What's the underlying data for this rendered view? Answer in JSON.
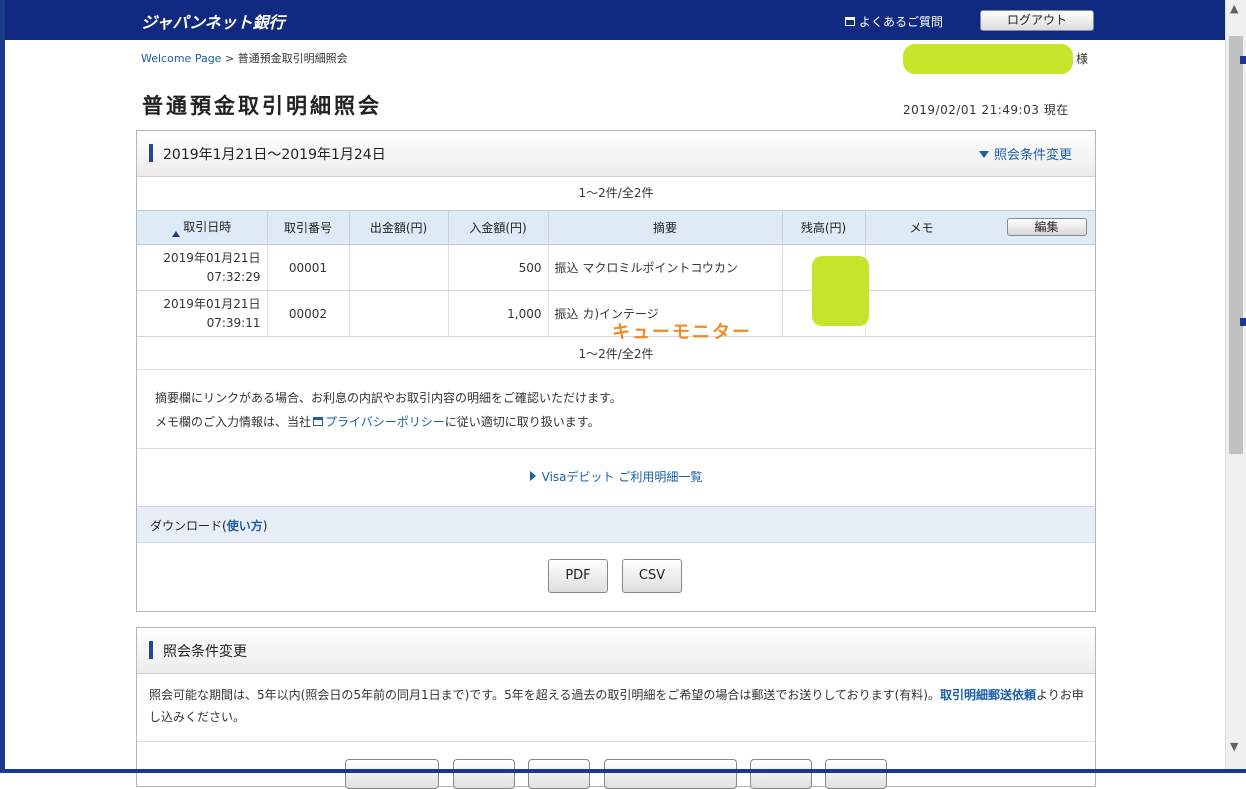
{
  "header": {
    "logo": "ジャパンネット銀行",
    "faq_label": "よくあるご質問",
    "logout_label": "ログアウト"
  },
  "breadcrumb": {
    "home": "Welcome Page",
    "separator": ">",
    "current": "普通預金取引明細照会"
  },
  "user": {
    "honorific": "様"
  },
  "page": {
    "title": "普通預金取引明細照会",
    "timestamp": "2019/02/01  21:49:03 現在"
  },
  "statement": {
    "period": "2019年1月21日～2019年1月24日",
    "change_link": "照会条件変更",
    "count_top": "1～2件/全2件",
    "count_bottom": "1～2件/全2件",
    "columns": [
      "取引日時",
      "取引番号",
      "出金額(円)",
      "入金額(円)",
      "摘要",
      "残高(円)",
      "メモ"
    ],
    "edit_label": "編集",
    "rows": [
      {
        "date": "2019年01月21日",
        "time": "07:32:29",
        "number": "00001",
        "withdrawal": "",
        "deposit": "500",
        "description": "振込 マクロミルポイントコウカン",
        "balance": "",
        "memo": ""
      },
      {
        "date": "2019年01月21日",
        "time": "07:39:11",
        "number": "00002",
        "withdrawal": "",
        "deposit": "1,000",
        "description": "振込 カ)インテージ",
        "balance": "",
        "memo": ""
      }
    ],
    "overlay_annotation": "キューモニター"
  },
  "notes": {
    "line1": "摘要欄にリンクがある場合、お利息の内訳やお取引内容の明細をご確認いただけます。",
    "line2_pre": "メモ欄のご入力情報は、当社",
    "line2_link": "プライバシーポリシー",
    "line2_post": "に従い適切に取り扱います。"
  },
  "visa_link": "Visaデビット ご利用明細一覧",
  "download": {
    "label_pre": "ダウンロード(",
    "label_link": "使い方",
    "label_post": ")",
    "pdf": "PDF",
    "csv": "CSV"
  },
  "conditions": {
    "title": "照会条件変更",
    "text_pre": "照会可能な期間は、5年以内(照会日の5年前の同月1日まで)です。5年を超える過去の取引明細をご希望の場合は郵送でお送りしております(有料)。",
    "text_link": "取引明細郵送依頼",
    "text_post": "よりお申し込みください。"
  },
  "colors": {
    "header_bg": "#0f2a80",
    "link": "#1a5fa8",
    "table_header_bg": "#deebf7",
    "redaction": "#c6e52a",
    "overlay_text": "#f08a24"
  }
}
